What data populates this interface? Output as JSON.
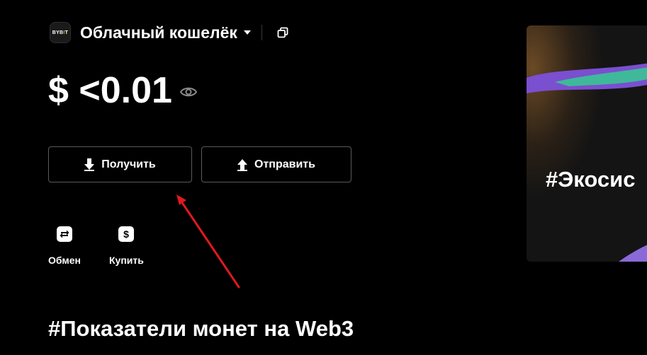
{
  "wallet": {
    "logo_text": "BYBIT",
    "title": "Облачный кошелёк",
    "balance": "$ <0.01"
  },
  "actions": {
    "receive_label": "Получить",
    "send_label": "Отправить"
  },
  "quick_actions": [
    {
      "label": "Обмен",
      "icon": "swap-icon"
    },
    {
      "label": "Купить",
      "icon": "dollar-icon"
    }
  ],
  "section": {
    "title": "#Показатели монет на Web3"
  },
  "banner": {
    "title": "#Экосис"
  },
  "annotation": {
    "color": "#e0191d"
  }
}
